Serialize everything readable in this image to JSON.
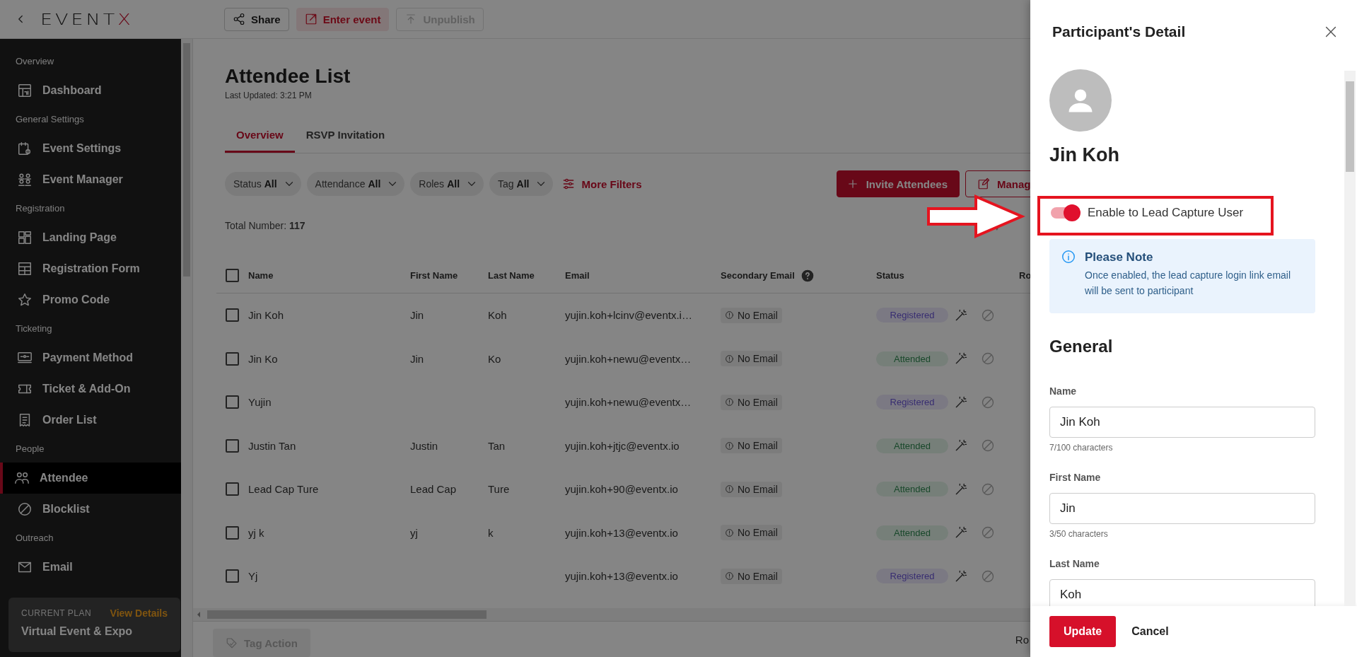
{
  "header": {
    "logo": "EVENTX",
    "buttons": [
      {
        "label": "Share",
        "kind": "outline"
      },
      {
        "label": "Enter event",
        "kind": "tinted"
      },
      {
        "label": "Unpublish",
        "kind": "disabled"
      }
    ]
  },
  "sidebar": {
    "sections": [
      {
        "title": "Overview",
        "items": [
          {
            "label": "Dashboard",
            "selected": false
          }
        ]
      },
      {
        "title": "General Settings",
        "items": [
          {
            "label": "Event Settings",
            "selected": false
          },
          {
            "label": "Event Manager",
            "selected": false
          }
        ]
      },
      {
        "title": "Registration",
        "items": [
          {
            "label": "Landing Page",
            "selected": false
          },
          {
            "label": "Registration Form",
            "selected": false
          },
          {
            "label": "Promo Code",
            "selected": false
          }
        ]
      },
      {
        "title": "Ticketing",
        "items": [
          {
            "label": "Payment Method",
            "selected": false
          },
          {
            "label": "Ticket & Add-On",
            "selected": false
          },
          {
            "label": "Order List",
            "selected": false
          }
        ]
      },
      {
        "title": "People",
        "items": [
          {
            "label": "Attendee",
            "selected": true
          },
          {
            "label": "Blocklist",
            "selected": false
          }
        ]
      },
      {
        "title": "Outreach",
        "items": [
          {
            "label": "Email",
            "selected": false
          }
        ]
      }
    ],
    "plan": {
      "label": "CURRENT PLAN",
      "link": "View Details",
      "name": "Virtual Event & Expo"
    }
  },
  "page": {
    "title": "Attendee List",
    "updated": "Last Updated: 3:21 PM",
    "tabs": [
      {
        "label": "Overview",
        "selected": true
      },
      {
        "label": "RSVP Invitation",
        "selected": false
      }
    ],
    "filters": [
      {
        "label": "Status",
        "value": "All"
      },
      {
        "label": "Attendance",
        "value": "All"
      },
      {
        "label": "Roles",
        "value": "All"
      },
      {
        "label": "Tag",
        "value": "All"
      }
    ],
    "more_filters": "More Filters",
    "actions": [
      {
        "label": "Invite Attendees",
        "kind": "primary"
      },
      {
        "label": "Manag",
        "kind": "outline"
      }
    ],
    "total": "Total Number: **117**"
  },
  "table": {
    "select_all": {
      "checked": false
    },
    "columns": [
      "Name",
      "First Name",
      "Last Name",
      "Email",
      "Secondary Email",
      "Status",
      "Ro"
    ],
    "rows": [
      {
        "checked": false,
        "name": "Jin Koh",
        "first_name": "Jin",
        "last_name": "Koh",
        "email": "yujin.koh+lcinv@eventx.i…",
        "secondary_email": "No Email",
        "status": "Registered",
        "kind": "registered"
      },
      {
        "checked": false,
        "name": "Jin Ko",
        "first_name": "Jin",
        "last_name": "Ko",
        "email": "yujin.koh+newu@eventx…",
        "secondary_email": "No Email",
        "status": "Attended",
        "kind": "attended"
      },
      {
        "checked": false,
        "name": "Yujin",
        "email": "yujin.koh+newu@eventx…",
        "secondary_email": "No Email",
        "status": "Registered",
        "kind": "registered"
      },
      {
        "checked": false,
        "name": "Justin Tan",
        "first_name": "Justin",
        "last_name": "Tan",
        "email": "yujin.koh+jtjc@eventx.io",
        "secondary_email": "No Email",
        "status": "Attended",
        "kind": "attended"
      },
      {
        "checked": false,
        "name": "Lead Cap Ture",
        "first_name": "Lead Cap",
        "last_name": "Ture",
        "email": "yujin.koh+90@eventx.io",
        "secondary_email": "No Email",
        "status": "Attended",
        "kind": "attended"
      },
      {
        "checked": false,
        "name": "yj k",
        "first_name": "yj",
        "last_name": "k",
        "email": "yujin.koh+13@eventx.io",
        "secondary_email": "No Email",
        "status": "Attended",
        "kind": "attended"
      },
      {
        "checked": false,
        "name": "Yj",
        "email": "yujin.koh+13@eventx.io",
        "secondary_email": "No Email",
        "status": "Registered",
        "kind": "registered"
      }
    ]
  },
  "footer": {
    "tag_action": "Tag Action",
    "rows_label": "Ro"
  },
  "drawer": {
    "title": "Participant's Detail",
    "name": "Jin Koh",
    "lead_capture": {
      "label": "Enable to Lead Capture User",
      "on": true
    },
    "note": {
      "title": "Please Note",
      "text": "Once enabled, the lead capture login link email will be sent to participant"
    },
    "section": "General",
    "fields": [
      {
        "label": "Name",
        "value": "Jin Koh",
        "counter": "7/100 characters"
      },
      {
        "label": "First Name",
        "value": "Jin",
        "counter": "3/50 characters"
      },
      {
        "label": "Last Name",
        "value": "Koh"
      }
    ],
    "buttons": [
      {
        "label": "Update",
        "kind": "primary"
      },
      {
        "label": "Cancel",
        "kind": "text"
      }
    ]
  }
}
